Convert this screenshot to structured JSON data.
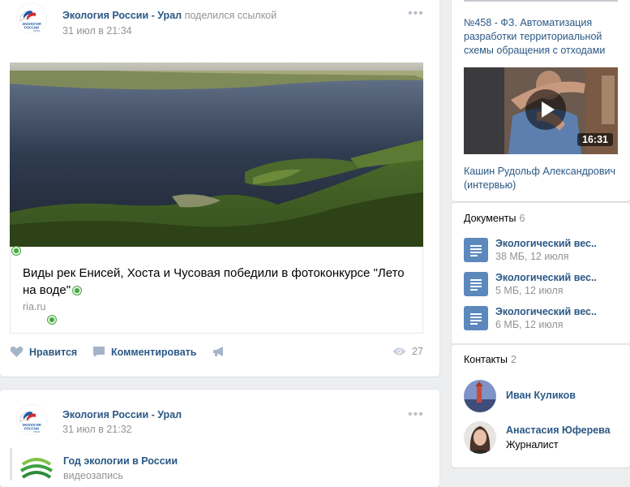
{
  "post1": {
    "author": "Экология России - Урал",
    "action": "поделился ссылкой",
    "date": "31 июл в 21:34",
    "link_title": "Виды рек Енисей, Хоста и Чусовая победили в фотоконкурсе \"Лето на воде\"",
    "link_source": "ria.ru",
    "like_label": "Нравится",
    "comment_label": "Комментировать",
    "views": "27"
  },
  "post2": {
    "author": "Экология России - Урал",
    "date": "31 июл в 21:32",
    "attachment_title": "Год экологии в России",
    "attachment_sub": "видеозапись"
  },
  "sidebar": {
    "article_title": "№458 - ФЗ. Автоматизация разработки территориальной схемы обращения с отходами",
    "video_duration": "16:31",
    "video_title": "Кашин Рудольф Александрович (интервью)",
    "documents_label": "Документы",
    "documents_count": "6",
    "documents": [
      {
        "name": "Экологический вес..",
        "meta": "38 МБ, 12 июля"
      },
      {
        "name": "Экологический вес..",
        "meta": "5 МБ, 12 июля"
      },
      {
        "name": "Экологический вес..",
        "meta": "6 МБ, 12 июля"
      }
    ],
    "contacts_label": "Контакты",
    "contacts_count": "2",
    "contacts": [
      {
        "name": "Иван Куликов",
        "role": ""
      },
      {
        "name": "Анастасия Юферева",
        "role": "Журналист"
      }
    ]
  },
  "logo_text": "ЭКОЛОГИЯ РОССИИ УРАЛ",
  "colors": {
    "link": "#2a5885",
    "muted": "#939393",
    "bg": "#edeef0",
    "doc": "#5b88bd",
    "green": "#44a844"
  }
}
